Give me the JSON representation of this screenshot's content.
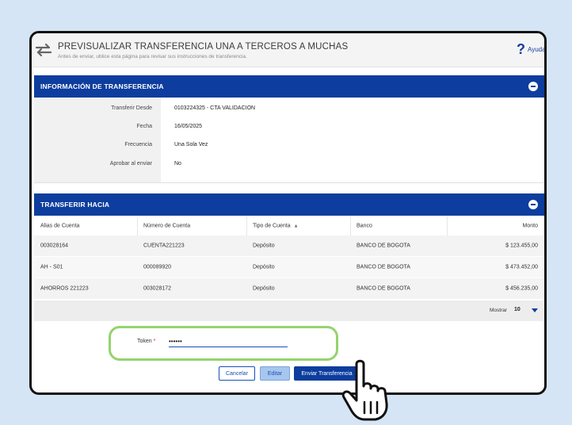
{
  "header": {
    "title": "PREVISUALIZAR TRANSFERENCIA UNA A TERCEROS A MUCHAS",
    "subtitle": "Antes de enviar, ublice esta página para revisar sus instrucciones de transferencia.",
    "help_label": "Ayuda"
  },
  "transfer_info": {
    "title": "INFORMACIÓN DE TRANSFERENCIA",
    "rows": [
      {
        "label": "Transferir Desde",
        "value": "0103224325 - CTA VALIDACION"
      },
      {
        "label": "Fecha",
        "value": "16/05/2025"
      },
      {
        "label": "Frecuencia",
        "value": "Una Sola Vez"
      },
      {
        "label": "Aprobar al enviar",
        "value": "No"
      }
    ]
  },
  "transfer_to": {
    "title": "TRANSFERIR HACIA",
    "columns": [
      "Alias de Cuenta",
      "Número de Cuenta",
      "Tipo de Cuenta",
      "Banco",
      "Monto"
    ],
    "sorted_column": "Tipo de Cuenta",
    "rows": [
      {
        "alias": "003028164",
        "account": "CUENTA221223",
        "type": "Depósito",
        "bank": "BANCO DE BOGOTA",
        "amount": "$ 123.455,00"
      },
      {
        "alias": "AH - S01",
        "account": "000089920",
        "type": "Depósito",
        "bank": "BANCO DE BOGOTA",
        "amount": "$ 473.452,00"
      },
      {
        "alias": "AHORROS 221223",
        "account": "003028172",
        "type": "Depósito",
        "bank": "BANCO DE BOGOTA",
        "amount": "$ 456.235,00"
      }
    ],
    "pager": {
      "label": "Mostrar",
      "value": "10"
    }
  },
  "token": {
    "label": "Token",
    "required_mark": "*",
    "value": "••••••"
  },
  "actions": {
    "cancel": "Cancelar",
    "edit": "Editar",
    "send": "Enviar Transferencia"
  },
  "colors": {
    "primary": "#0d3d9e",
    "highlight": "#95d36e",
    "background": "#d5e5f6"
  }
}
